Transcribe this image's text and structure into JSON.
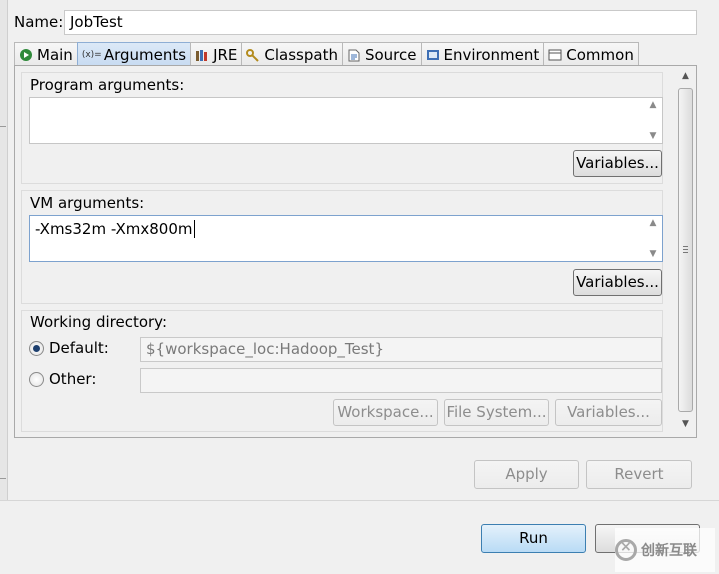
{
  "name": {
    "label": "Name:",
    "value": "JobTest"
  },
  "tabs": [
    {
      "label": "Main",
      "icon": "main-run-icon"
    },
    {
      "label": "Arguments",
      "icon": "arguments-icon",
      "icon_text": "(x)="
    },
    {
      "label": "JRE",
      "icon": "jre-library-icon"
    },
    {
      "label": "Classpath",
      "icon": "classpath-icon"
    },
    {
      "label": "Source",
      "icon": "source-icon"
    },
    {
      "label": "Environment",
      "icon": "environment-icon"
    },
    {
      "label": "Common",
      "icon": "common-icon"
    }
  ],
  "program_arguments": {
    "title": "Program arguments:",
    "value": "",
    "variables_label": "Variables..."
  },
  "vm_arguments": {
    "title": "VM arguments:",
    "value": "-Xms32m -Xmx800m",
    "variables_label": "Variables..."
  },
  "working_directory": {
    "title": "Working directory:",
    "default_label": "Default:",
    "default_value": "${workspace_loc:Hadoop_Test}",
    "other_label": "Other:",
    "other_value": "",
    "workspace_label": "Workspace...",
    "filesystem_label": "File System...",
    "variables_label": "Variables..."
  },
  "buttons": {
    "apply": "Apply",
    "revert": "Revert",
    "run": "Run"
  },
  "watermark": {
    "text": "创新互联"
  },
  "colors": {
    "active_tab": "#c6daf1",
    "focus_border": "#7da2ce",
    "run_button": "#b9dbf5"
  }
}
